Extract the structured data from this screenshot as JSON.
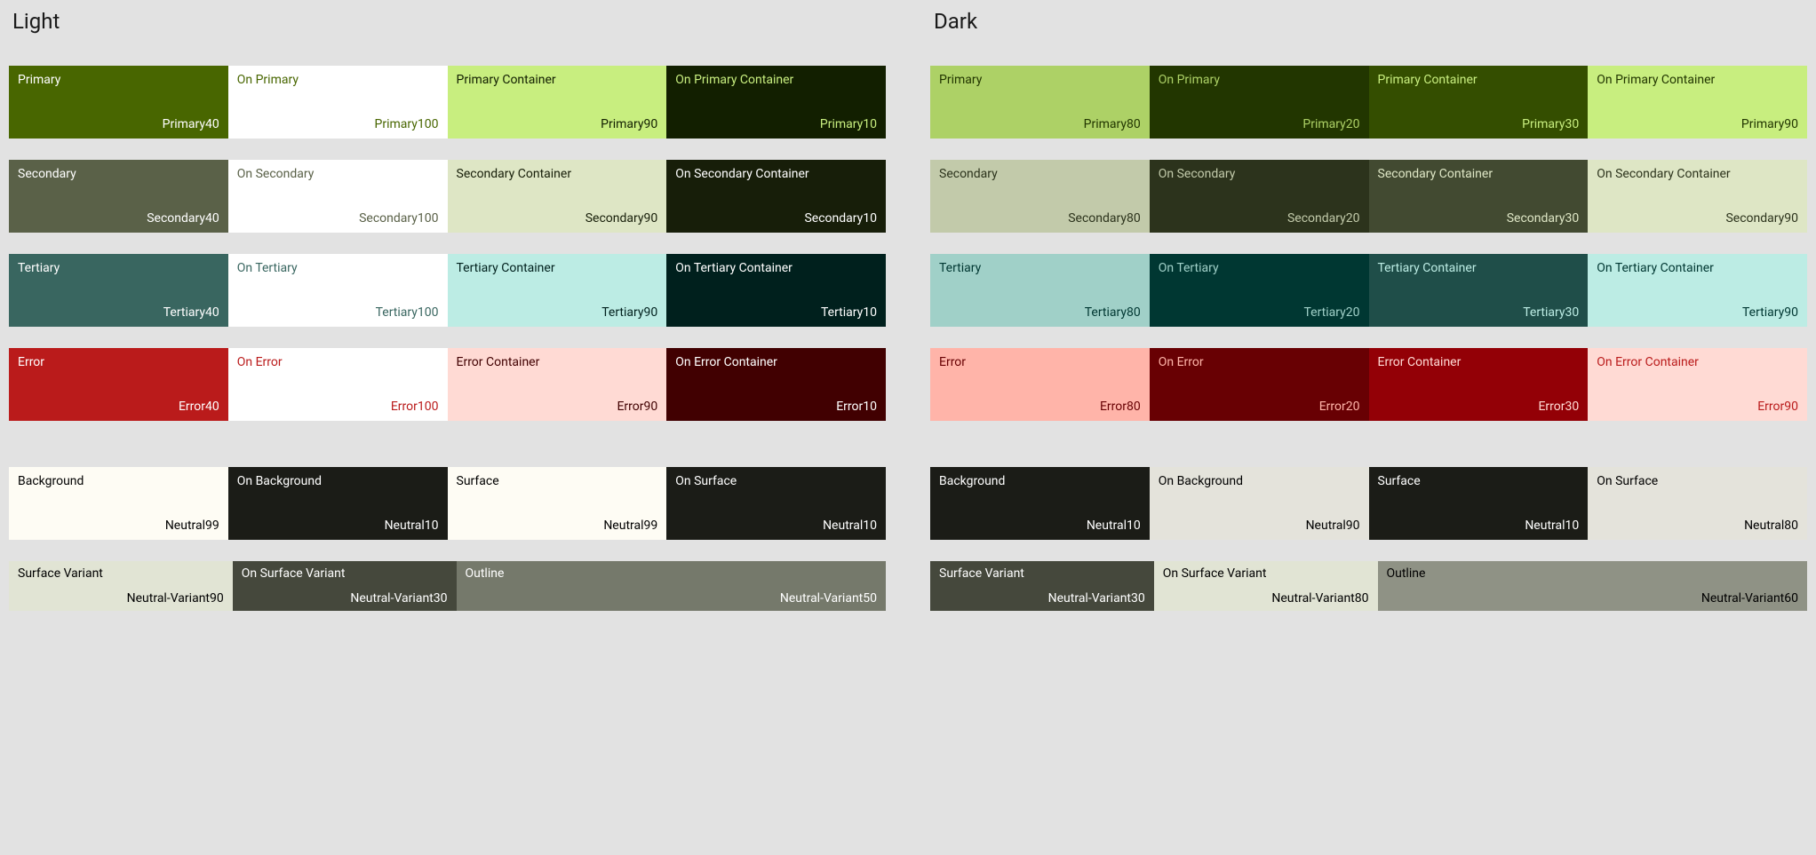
{
  "chart_data": {
    "type": "table",
    "title": "Material color scheme tokens (Light vs Dark)",
    "schemes": [
      {
        "name": "Light",
        "roles": [
          {
            "role": "Primary",
            "token": "Primary40",
            "bg": "#486600",
            "fg": "#ffffff"
          },
          {
            "role": "On Primary",
            "token": "Primary100",
            "bg": "#ffffff",
            "fg": "#486600"
          },
          {
            "role": "Primary Container",
            "token": "Primary90",
            "bg": "#c8ee7f",
            "fg": "#121f00"
          },
          {
            "role": "On Primary Container",
            "token": "Primary10",
            "bg": "#121f00",
            "fg": "#c8ee7f"
          },
          {
            "role": "Secondary",
            "token": "Secondary40",
            "bg": "#5a6148",
            "fg": "#ffffff"
          },
          {
            "role": "On Secondary",
            "token": "Secondary100",
            "bg": "#ffffff",
            "fg": "#5a6148"
          },
          {
            "role": "Secondary Container",
            "token": "Secondary90",
            "bg": "#dee6c5",
            "fg": "#171e09"
          },
          {
            "role": "On Secondary Container",
            "token": "Secondary10",
            "bg": "#171e09",
            "fg": "#ffffff"
          },
          {
            "role": "Tertiary",
            "token": "Tertiary40",
            "bg": "#396660",
            "fg": "#ffffff"
          },
          {
            "role": "On Tertiary",
            "token": "Tertiary100",
            "bg": "#ffffff",
            "fg": "#396660"
          },
          {
            "role": "Tertiary Container",
            "token": "Tertiary90",
            "bg": "#bcece4",
            "fg": "#00201d"
          },
          {
            "role": "On Tertiary Container",
            "token": "Tertiary10",
            "bg": "#00201d",
            "fg": "#ffffff"
          },
          {
            "role": "Error",
            "token": "Error40",
            "bg": "#ba1b1b",
            "fg": "#ffffff"
          },
          {
            "role": "On Error",
            "token": "Error100",
            "bg": "#ffffff",
            "fg": "#ba1b1b"
          },
          {
            "role": "Error Container",
            "token": "Error90",
            "bg": "#ffdad4",
            "fg": "#410001"
          },
          {
            "role": "On Error Container",
            "token": "Error10",
            "bg": "#410001",
            "fg": "#ffffff"
          },
          {
            "role": "Background",
            "token": "Neutral99",
            "bg": "#fefcf4",
            "fg": "#000000"
          },
          {
            "role": "On Background",
            "token": "Neutral10",
            "bg": "#1b1c17",
            "fg": "#ffffff"
          },
          {
            "role": "Surface",
            "token": "Neutral99",
            "bg": "#fefcf4",
            "fg": "#000000"
          },
          {
            "role": "On Surface",
            "token": "Neutral10",
            "bg": "#1b1c17",
            "fg": "#ffffff"
          },
          {
            "role": "Surface Variant",
            "token": "Neutral-Variant90",
            "bg": "#e1e4d4",
            "fg": "#000000"
          },
          {
            "role": "On Surface Variant",
            "token": "Neutral-Variant30",
            "bg": "#45483c",
            "fg": "#ffffff"
          },
          {
            "role": "Outline",
            "token": "Neutral-Variant50",
            "bg": "#75796b",
            "fg": "#ffffff"
          }
        ]
      },
      {
        "name": "Dark",
        "roles": [
          {
            "role": "Primary",
            "token": "Primary80",
            "bg": "#add166",
            "fg": "#223600"
          },
          {
            "role": "On Primary",
            "token": "Primary20",
            "bg": "#223600",
            "fg": "#add166"
          },
          {
            "role": "Primary Container",
            "token": "Primary30",
            "bg": "#344e00",
            "fg": "#c8ee7f"
          },
          {
            "role": "On Primary Container",
            "token": "Primary90",
            "bg": "#c8ee7f",
            "fg": "#223600"
          },
          {
            "role": "Secondary",
            "token": "Secondary80",
            "bg": "#c2caaa",
            "fg": "#2c331c"
          },
          {
            "role": "On Secondary",
            "token": "Secondary20",
            "bg": "#2c331c",
            "fg": "#c2caaa"
          },
          {
            "role": "Secondary Container",
            "token": "Secondary30",
            "bg": "#424a31",
            "fg": "#dee6c5"
          },
          {
            "role": "On Secondary Container",
            "token": "Secondary90",
            "bg": "#dee6c5",
            "fg": "#2c331c"
          },
          {
            "role": "Tertiary",
            "token": "Tertiary80",
            "bg": "#a0d0c8",
            "fg": "#003732"
          },
          {
            "role": "On Tertiary",
            "token": "Tertiary20",
            "bg": "#003732",
            "fg": "#a0d0c8"
          },
          {
            "role": "Tertiary Container",
            "token": "Tertiary30",
            "bg": "#1f4e49",
            "fg": "#bcece4"
          },
          {
            "role": "On Tertiary Container",
            "token": "Tertiary90",
            "bg": "#bcece4",
            "fg": "#003732"
          },
          {
            "role": "Error",
            "token": "Error80",
            "bg": "#ffb4a9",
            "fg": "#680003"
          },
          {
            "role": "On Error",
            "token": "Error20",
            "bg": "#680003",
            "fg": "#ffb4a9"
          },
          {
            "role": "Error Container",
            "token": "Error30",
            "bg": "#930006",
            "fg": "#ffdad4"
          },
          {
            "role": "On Error Container",
            "token": "Error90",
            "bg": "#ffdad4",
            "fg": "#ba1b1b"
          },
          {
            "role": "Background",
            "token": "Neutral10",
            "bg": "#1b1c17",
            "fg": "#ffffff"
          },
          {
            "role": "On Background",
            "token": "Neutral90",
            "bg": "#e4e3db",
            "fg": "#000000"
          },
          {
            "role": "Surface",
            "token": "Neutral10",
            "bg": "#1b1c17",
            "fg": "#ffffff"
          },
          {
            "role": "On Surface",
            "token": "Neutral80",
            "bg": "#e4e3db",
            "fg": "#000000"
          },
          {
            "role": "Surface Variant",
            "token": "Neutral-Variant30",
            "bg": "#45483c",
            "fg": "#ffffff"
          },
          {
            "role": "On Surface Variant",
            "token": "Neutral-Variant80",
            "bg": "#e1e4d4",
            "fg": "#000000"
          },
          {
            "role": "Outline",
            "token": "Neutral-Variant60",
            "bg": "#8f9285",
            "fg": "#000000"
          }
        ]
      }
    ]
  },
  "labels": {
    "light": "Light",
    "dark": "Dark"
  }
}
